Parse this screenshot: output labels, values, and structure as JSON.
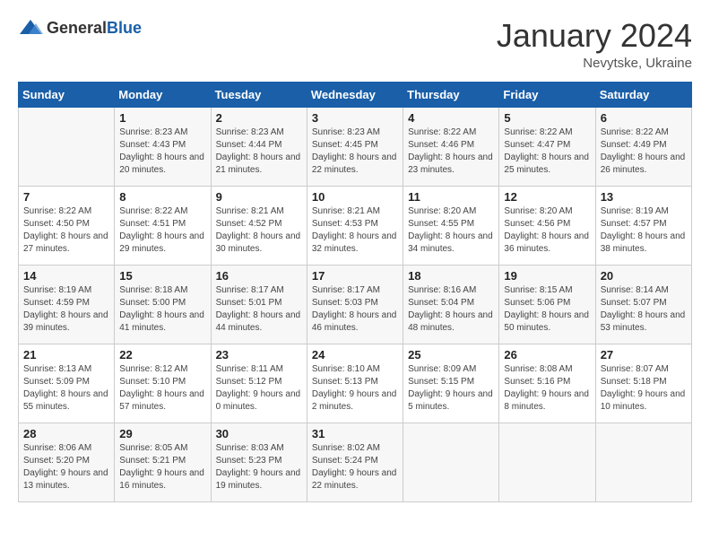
{
  "logo": {
    "general": "General",
    "blue": "Blue"
  },
  "header": {
    "month": "January 2024",
    "location": "Nevytske, Ukraine"
  },
  "weekdays": [
    "Sunday",
    "Monday",
    "Tuesday",
    "Wednesday",
    "Thursday",
    "Friday",
    "Saturday"
  ],
  "weeks": [
    [
      {
        "day": "",
        "sunrise": "",
        "sunset": "",
        "daylight": ""
      },
      {
        "day": "1",
        "sunrise": "Sunrise: 8:23 AM",
        "sunset": "Sunset: 4:43 PM",
        "daylight": "Daylight: 8 hours and 20 minutes."
      },
      {
        "day": "2",
        "sunrise": "Sunrise: 8:23 AM",
        "sunset": "Sunset: 4:44 PM",
        "daylight": "Daylight: 8 hours and 21 minutes."
      },
      {
        "day": "3",
        "sunrise": "Sunrise: 8:23 AM",
        "sunset": "Sunset: 4:45 PM",
        "daylight": "Daylight: 8 hours and 22 minutes."
      },
      {
        "day": "4",
        "sunrise": "Sunrise: 8:22 AM",
        "sunset": "Sunset: 4:46 PM",
        "daylight": "Daylight: 8 hours and 23 minutes."
      },
      {
        "day": "5",
        "sunrise": "Sunrise: 8:22 AM",
        "sunset": "Sunset: 4:47 PM",
        "daylight": "Daylight: 8 hours and 25 minutes."
      },
      {
        "day": "6",
        "sunrise": "Sunrise: 8:22 AM",
        "sunset": "Sunset: 4:49 PM",
        "daylight": "Daylight: 8 hours and 26 minutes."
      }
    ],
    [
      {
        "day": "7",
        "sunrise": "Sunrise: 8:22 AM",
        "sunset": "Sunset: 4:50 PM",
        "daylight": "Daylight: 8 hours and 27 minutes."
      },
      {
        "day": "8",
        "sunrise": "Sunrise: 8:22 AM",
        "sunset": "Sunset: 4:51 PM",
        "daylight": "Daylight: 8 hours and 29 minutes."
      },
      {
        "day": "9",
        "sunrise": "Sunrise: 8:21 AM",
        "sunset": "Sunset: 4:52 PM",
        "daylight": "Daylight: 8 hours and 30 minutes."
      },
      {
        "day": "10",
        "sunrise": "Sunrise: 8:21 AM",
        "sunset": "Sunset: 4:53 PM",
        "daylight": "Daylight: 8 hours and 32 minutes."
      },
      {
        "day": "11",
        "sunrise": "Sunrise: 8:20 AM",
        "sunset": "Sunset: 4:55 PM",
        "daylight": "Daylight: 8 hours and 34 minutes."
      },
      {
        "day": "12",
        "sunrise": "Sunrise: 8:20 AM",
        "sunset": "Sunset: 4:56 PM",
        "daylight": "Daylight: 8 hours and 36 minutes."
      },
      {
        "day": "13",
        "sunrise": "Sunrise: 8:19 AM",
        "sunset": "Sunset: 4:57 PM",
        "daylight": "Daylight: 8 hours and 38 minutes."
      }
    ],
    [
      {
        "day": "14",
        "sunrise": "Sunrise: 8:19 AM",
        "sunset": "Sunset: 4:59 PM",
        "daylight": "Daylight: 8 hours and 39 minutes."
      },
      {
        "day": "15",
        "sunrise": "Sunrise: 8:18 AM",
        "sunset": "Sunset: 5:00 PM",
        "daylight": "Daylight: 8 hours and 41 minutes."
      },
      {
        "day": "16",
        "sunrise": "Sunrise: 8:17 AM",
        "sunset": "Sunset: 5:01 PM",
        "daylight": "Daylight: 8 hours and 44 minutes."
      },
      {
        "day": "17",
        "sunrise": "Sunrise: 8:17 AM",
        "sunset": "Sunset: 5:03 PM",
        "daylight": "Daylight: 8 hours and 46 minutes."
      },
      {
        "day": "18",
        "sunrise": "Sunrise: 8:16 AM",
        "sunset": "Sunset: 5:04 PM",
        "daylight": "Daylight: 8 hours and 48 minutes."
      },
      {
        "day": "19",
        "sunrise": "Sunrise: 8:15 AM",
        "sunset": "Sunset: 5:06 PM",
        "daylight": "Daylight: 8 hours and 50 minutes."
      },
      {
        "day": "20",
        "sunrise": "Sunrise: 8:14 AM",
        "sunset": "Sunset: 5:07 PM",
        "daylight": "Daylight: 8 hours and 53 minutes."
      }
    ],
    [
      {
        "day": "21",
        "sunrise": "Sunrise: 8:13 AM",
        "sunset": "Sunset: 5:09 PM",
        "daylight": "Daylight: 8 hours and 55 minutes."
      },
      {
        "day": "22",
        "sunrise": "Sunrise: 8:12 AM",
        "sunset": "Sunset: 5:10 PM",
        "daylight": "Daylight: 8 hours and 57 minutes."
      },
      {
        "day": "23",
        "sunrise": "Sunrise: 8:11 AM",
        "sunset": "Sunset: 5:12 PM",
        "daylight": "Daylight: 9 hours and 0 minutes."
      },
      {
        "day": "24",
        "sunrise": "Sunrise: 8:10 AM",
        "sunset": "Sunset: 5:13 PM",
        "daylight": "Daylight: 9 hours and 2 minutes."
      },
      {
        "day": "25",
        "sunrise": "Sunrise: 8:09 AM",
        "sunset": "Sunset: 5:15 PM",
        "daylight": "Daylight: 9 hours and 5 minutes."
      },
      {
        "day": "26",
        "sunrise": "Sunrise: 8:08 AM",
        "sunset": "Sunset: 5:16 PM",
        "daylight": "Daylight: 9 hours and 8 minutes."
      },
      {
        "day": "27",
        "sunrise": "Sunrise: 8:07 AM",
        "sunset": "Sunset: 5:18 PM",
        "daylight": "Daylight: 9 hours and 10 minutes."
      }
    ],
    [
      {
        "day": "28",
        "sunrise": "Sunrise: 8:06 AM",
        "sunset": "Sunset: 5:20 PM",
        "daylight": "Daylight: 9 hours and 13 minutes."
      },
      {
        "day": "29",
        "sunrise": "Sunrise: 8:05 AM",
        "sunset": "Sunset: 5:21 PM",
        "daylight": "Daylight: 9 hours and 16 minutes."
      },
      {
        "day": "30",
        "sunrise": "Sunrise: 8:03 AM",
        "sunset": "Sunset: 5:23 PM",
        "daylight": "Daylight: 9 hours and 19 minutes."
      },
      {
        "day": "31",
        "sunrise": "Sunrise: 8:02 AM",
        "sunset": "Sunset: 5:24 PM",
        "daylight": "Daylight: 9 hours and 22 minutes."
      },
      {
        "day": "",
        "sunrise": "",
        "sunset": "",
        "daylight": ""
      },
      {
        "day": "",
        "sunrise": "",
        "sunset": "",
        "daylight": ""
      },
      {
        "day": "",
        "sunrise": "",
        "sunset": "",
        "daylight": ""
      }
    ]
  ]
}
